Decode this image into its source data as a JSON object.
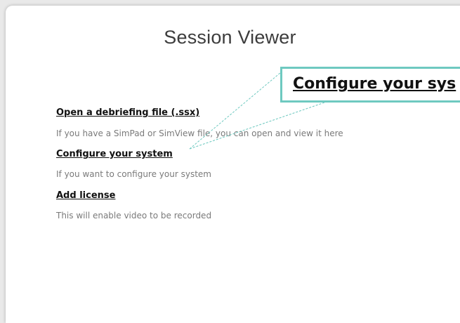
{
  "app": {
    "title": "Session Viewer"
  },
  "menu": {
    "open_file": {
      "label": "Open a debriefing file (.ssx)",
      "description": "If you have a SimPad or SimView file, you can open and view it here"
    },
    "configure": {
      "label": "Configure your system",
      "description": "If you want to configure your system"
    },
    "license": {
      "label": "Add license",
      "description": "This will enable video to be recorded"
    }
  },
  "zoom_callout": {
    "text": "Configure your sys",
    "border_color": "#6ec9c0"
  }
}
